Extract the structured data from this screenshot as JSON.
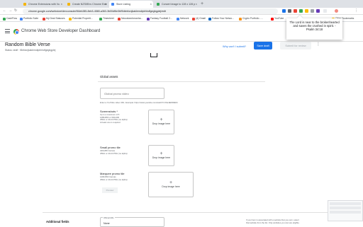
{
  "browser": {
    "tabs": [
      {
        "label": "Chrome Extensions with Vu",
        "color": "#f4b400"
      },
      {
        "label": "Create NZSIIEnv Chrome Exte",
        "color": "#f4b400"
      },
      {
        "label": "Store Listing",
        "color": "#4285f4"
      },
      {
        "label": "Convert image to 128 x 128 p",
        "color": "#34a853"
      }
    ],
    "new_tab": "+",
    "url": "chrome.google.com/webstore/devconsole/f46eb285-8eb3-4580-a363-3b00df6e3bf9/dtebicnjkaklemdipbhhdfgegbgplej/edit",
    "bookmarks": [
      {
        "label": "CashFlow",
        "color": "#34a853"
      },
      {
        "label": "Portfolio Suite",
        "color": "#4285f4"
      },
      {
        "label": "My Deal Statuses",
        "color": "#ea4335"
      },
      {
        "label": "Potential Properti...",
        "color": "#fbbc04"
      },
      {
        "label": "Timesheet",
        "color": "#34a853"
      },
      {
        "label": "Neuralworkmanha...",
        "color": "#ea4335"
      },
      {
        "label": "Fantasy Football 2...",
        "color": "#673ab7"
      },
      {
        "label": "Network",
        "color": "#4285f4"
      },
      {
        "label": "(4) Gmail",
        "color": "#ea4335"
      },
      {
        "label": "Follow Your Netwo...",
        "color": "#0a66c2"
      },
      {
        "label": "Crypto Portfolio - ...",
        "color": "#f7931a"
      },
      {
        "label": "YouTube",
        "color": "#ff0000"
      },
      {
        "label": "Other Bookmarks",
        "color": "#fbbc04"
      }
    ]
  },
  "header": {
    "title": "Chrome Web Store Developer Dashboard"
  },
  "item": {
    "name": "Random Bible Verse",
    "status": "Status: draft  ·  f8ebicnjkaklemdipbhhdfgegbgplej",
    "why_link": "Why can't I submit?",
    "save_label": "Save draft",
    "submit_label": "Submit for review"
  },
  "tooltip": {
    "text": "The Lord is near to the brokenhearted and saves the crushed in spirit. - Psalm 34:18"
  },
  "form": {
    "global_assets": "Global assets",
    "promo_video_placeholder": "Global promo video",
    "promo_video_helper": "Enter a YouTube video URL. Example: https://www.youtube.com/watch?v=f3e4Ek5RE64",
    "screenshots_label": "Screenshots *",
    "screenshots_notes": [
      "Up to a maximum of 5",
      "1280x800 or 640x400",
      "JPEG or 24-bit PNG (no alpha)",
      "At least one is required"
    ],
    "small_tile_label": "Small promo tile",
    "small_tile_notes": [
      "440x280 Canvas",
      "JPEG or 24-bit PNG (no alpha)"
    ],
    "marquee_label": "Marquee promo tile",
    "marquee_notes": [
      "1400x560 Canvas",
      "JPEG or 24-bit PNG (no alpha)"
    ],
    "drop_label": "Drop image here",
    "plus": "+",
    "preview_label": "Preview",
    "additional_fields": "Additional fields",
    "official_url_label": "Official URL",
    "official_url_value": "None",
    "side_note": "If your item is associated with a website that you own, select that website from the list. Only websites you own are eligible."
  }
}
